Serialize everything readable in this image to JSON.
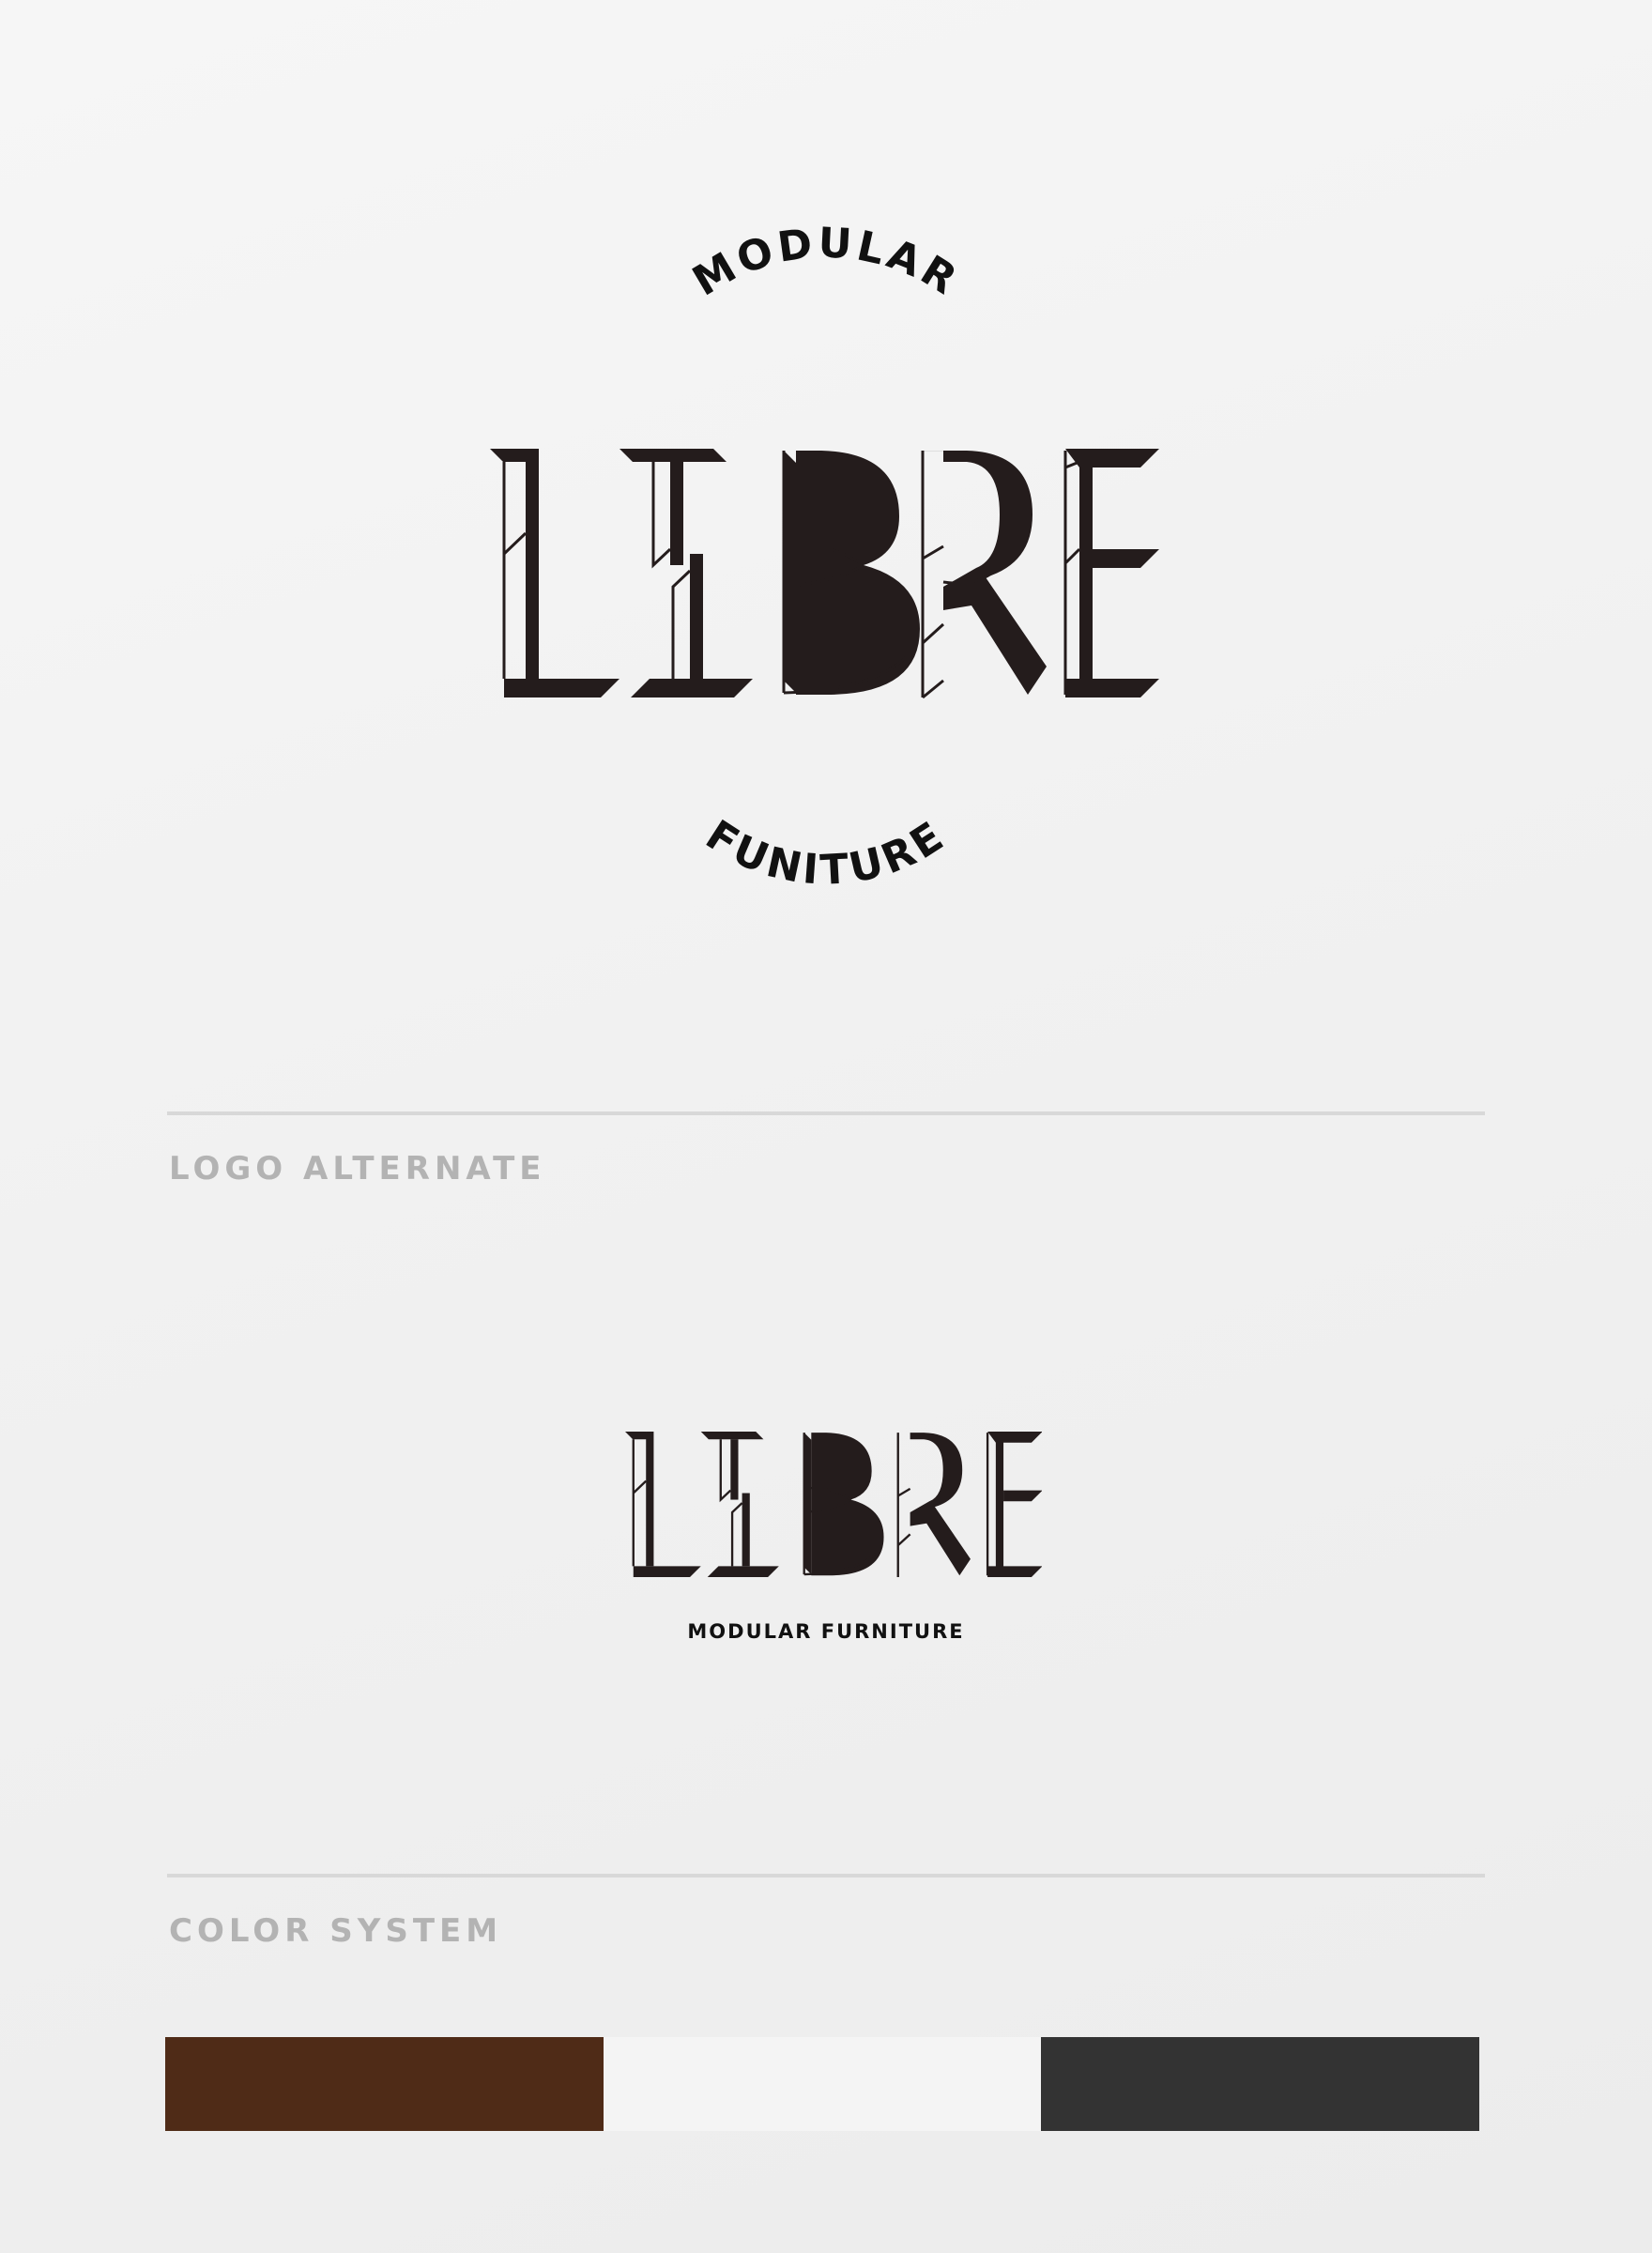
{
  "primary_logo": {
    "arc_top": "MODULAR",
    "arc_bottom": "FUNITURE",
    "wordmark": "LIBRE",
    "ink_color": "#241c1c"
  },
  "sections": {
    "alternate_label": "LOGO ALTERNATE",
    "color_label": "COLOR SYSTEM"
  },
  "alternate_logo": {
    "wordmark": "LIBRE",
    "tagline": "MODULAR FURNITURE"
  },
  "colors": [
    {
      "name": "brown",
      "hex": "#4f2b17"
    },
    {
      "name": "off-white",
      "hex": "#f4f4f4"
    },
    {
      "name": "charcoal",
      "hex": "#333333"
    }
  ]
}
